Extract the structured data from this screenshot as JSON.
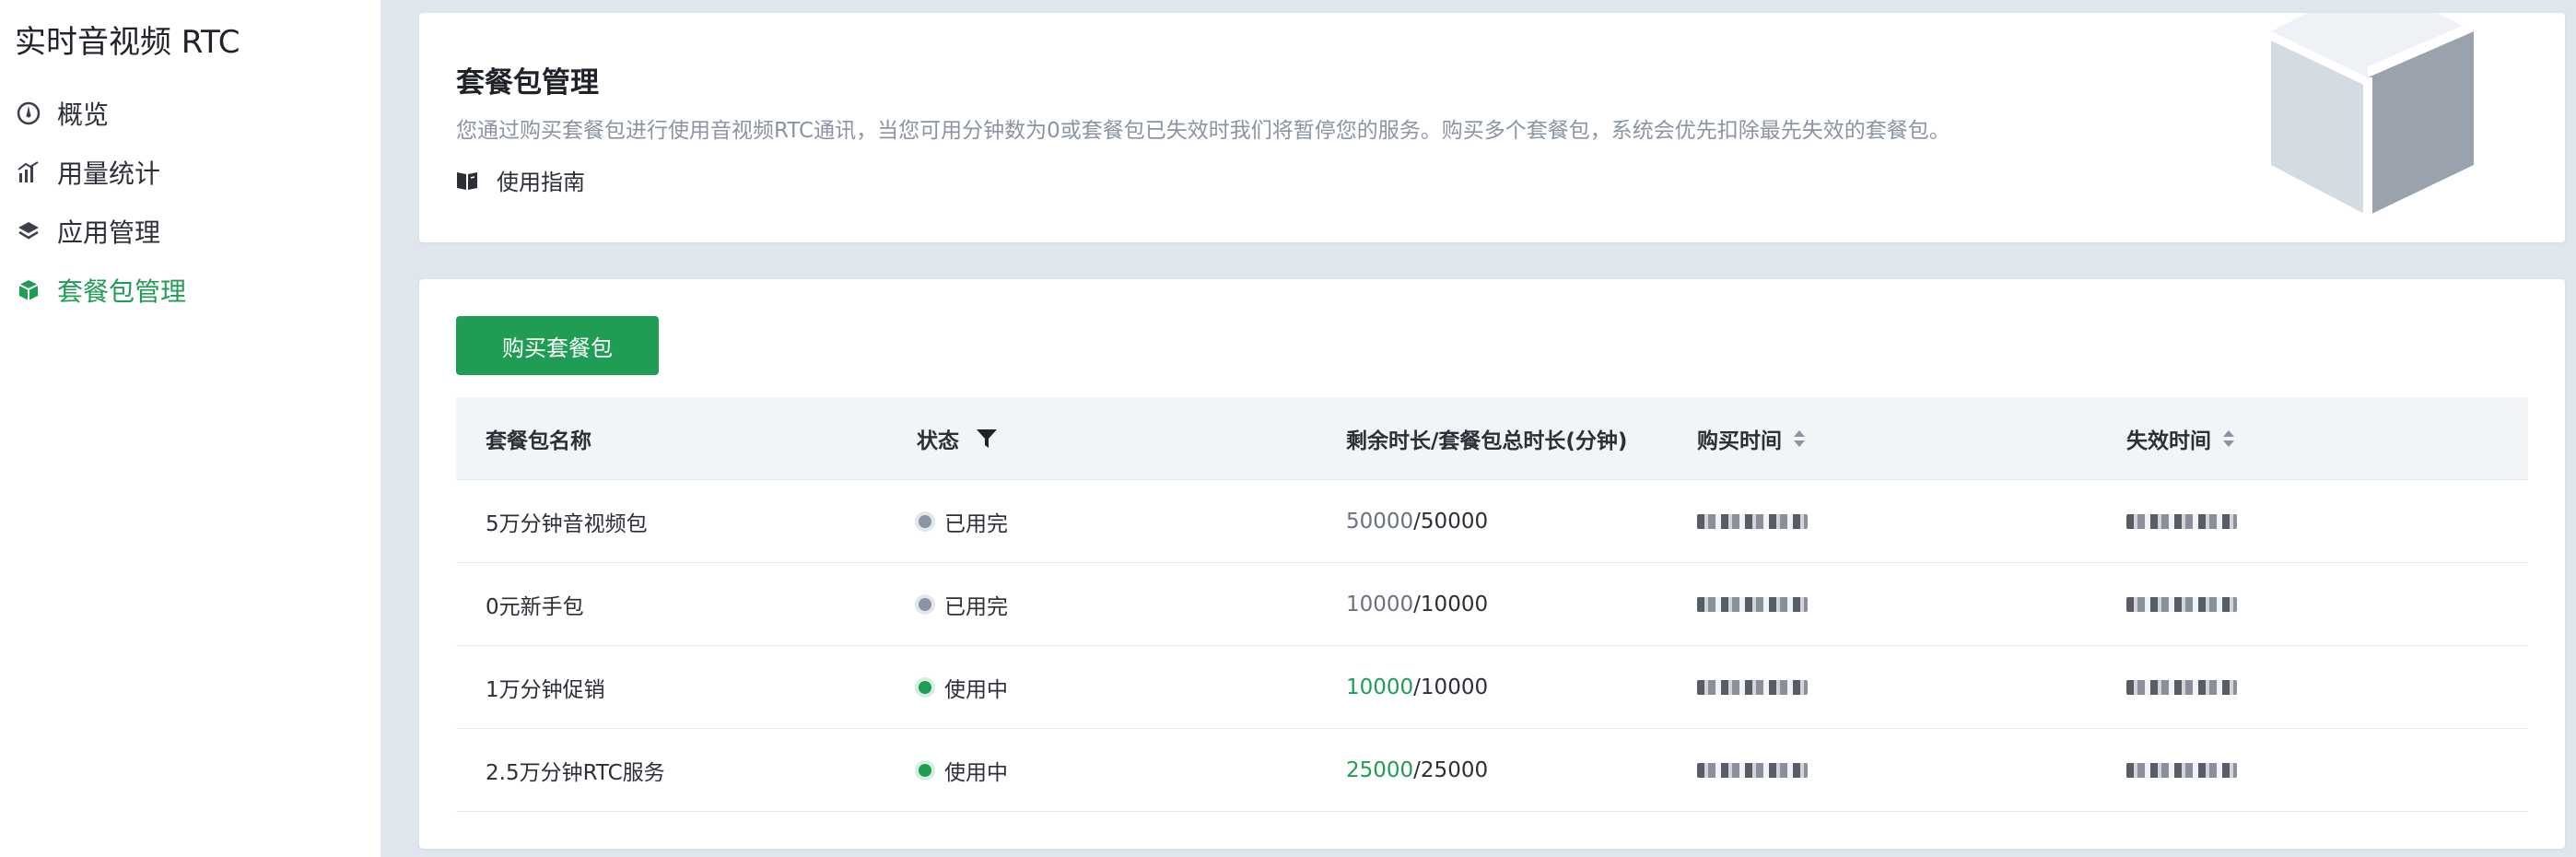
{
  "sidebar": {
    "title": "实时音视频 RTC",
    "items": [
      {
        "label": "概览",
        "icon": "dashboard-icon",
        "active": false
      },
      {
        "label": "用量统计",
        "icon": "bar-chart-icon",
        "active": false
      },
      {
        "label": "应用管理",
        "icon": "layers-icon",
        "active": false
      },
      {
        "label": "套餐包管理",
        "icon": "package-icon",
        "active": true
      }
    ]
  },
  "intro": {
    "title": "套餐包管理",
    "description": "您通过购买套餐包进行使用音视频RTC通讯，当您可用分钟数为0或套餐包已失效时我们将暂停您的服务。购买多个套餐包，系统会优先扣除最先失效的套餐包。",
    "guide_label": "使用指南"
  },
  "toolbar": {
    "buy_label": "购买套餐包"
  },
  "table": {
    "headers": {
      "name": "套餐包名称",
      "status": "状态",
      "remaining": "剩余时长/套餐包总时长(分钟)",
      "purchase_time": "购买时间",
      "expire_time": "失效时间"
    },
    "rows": [
      {
        "name": "5万分钟音视频包",
        "status": "已用完",
        "status_kind": "used-up",
        "remaining": "50000",
        "total": "/50000"
      },
      {
        "name": "0元新手包",
        "status": "已用完",
        "status_kind": "used-up",
        "remaining": "10000",
        "total": "/10000"
      },
      {
        "name": "1万分钟促销",
        "status": "使用中",
        "status_kind": "in-use",
        "remaining": "10000",
        "total": "/10000"
      },
      {
        "name": "2.5万分钟RTC服务",
        "status": "使用中",
        "status_kind": "in-use",
        "remaining": "25000",
        "total": "/25000"
      }
    ]
  },
  "colors": {
    "accent": "#1f9d55",
    "muted": "#8a94a3",
    "background": "#dfe6ee"
  }
}
